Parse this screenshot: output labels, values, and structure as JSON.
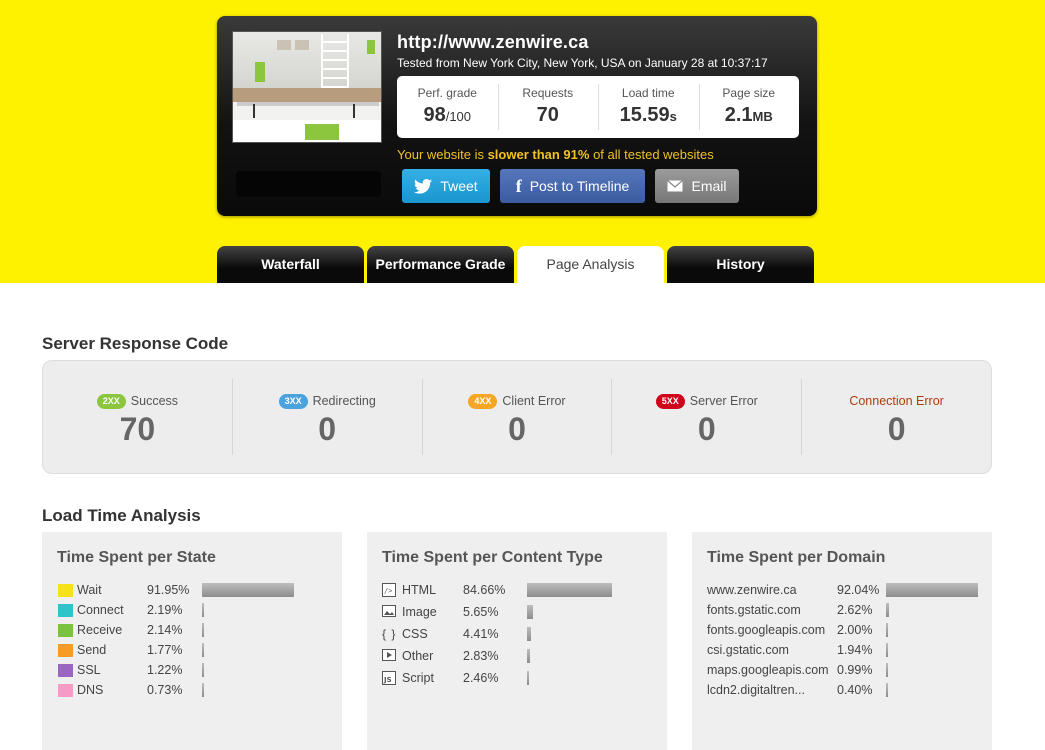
{
  "hero": {
    "url": "http://www.zenwire.ca",
    "tested_line": "Tested from New York City, New York, USA on January 28 at 10:37:17",
    "stats": [
      {
        "label": "Perf. grade",
        "value": "98",
        "unit": "/100"
      },
      {
        "label": "Requests",
        "value": "70",
        "unit": ""
      },
      {
        "label": "Load time",
        "value": "15.59",
        "unit": "s"
      },
      {
        "label": "Page size",
        "value": "2.1",
        "unit": "MB"
      }
    ],
    "speed": {
      "prefix": "Your website is ",
      "emphasis": "slower than 91%",
      "suffix": " of all tested websites"
    },
    "share": {
      "tweet": "Tweet",
      "facebook": "Post to Timeline",
      "email": "Email"
    }
  },
  "tabs": [
    {
      "label": "Waterfall",
      "active": false
    },
    {
      "label": "Performance Grade",
      "active": false
    },
    {
      "label": "Page Analysis",
      "active": true
    },
    {
      "label": "History",
      "active": false
    }
  ],
  "server_response": {
    "title": "Server Response Code",
    "codes": [
      {
        "badge": "2XX",
        "label": "Success",
        "count": "70",
        "color": "#8cc63f"
      },
      {
        "badge": "3XX",
        "label": "Redirecting",
        "count": "0",
        "color": "#4aa3df"
      },
      {
        "badge": "4XX",
        "label": "Client Error",
        "count": "0",
        "color": "#f5a623"
      },
      {
        "badge": "5XX",
        "label": "Server Error",
        "count": "0",
        "color": "#d0021b"
      },
      {
        "badge": "",
        "label": "Connection Error",
        "count": "0",
        "color": "#b03a10"
      }
    ]
  },
  "load_time": {
    "title": "Load Time Analysis",
    "per_state": {
      "title": "Time Spent per State",
      "rows": [
        {
          "label": "Wait",
          "pct": "91.95%",
          "value": 91.95,
          "color": "#f7e21a"
        },
        {
          "label": "Connect",
          "pct": "2.19%",
          "value": 2.19,
          "color": "#2ec4c9"
        },
        {
          "label": "Receive",
          "pct": "2.14%",
          "value": 2.14,
          "color": "#7cc242"
        },
        {
          "label": "Send",
          "pct": "1.77%",
          "value": 1.77,
          "color": "#f59c26"
        },
        {
          "label": "SSL",
          "pct": "1.22%",
          "value": 1.22,
          "color": "#9b65c2"
        },
        {
          "label": "DNS",
          "pct": "0.73%",
          "value": 0.73,
          "color": "#f59bc6"
        }
      ]
    },
    "per_content": {
      "title": "Time Spent per Content Type",
      "rows": [
        {
          "label": "HTML",
          "pct": "84.66%",
          "value": 84.66,
          "icon": "html-icon"
        },
        {
          "label": "Image",
          "pct": "5.65%",
          "value": 5.65,
          "icon": "image-icon"
        },
        {
          "label": "CSS",
          "pct": "4.41%",
          "value": 4.41,
          "icon": "css-icon"
        },
        {
          "label": "Other",
          "pct": "2.83%",
          "value": 2.83,
          "icon": "other-icon"
        },
        {
          "label": "Script",
          "pct": "2.46%",
          "value": 2.46,
          "icon": "script-icon"
        }
      ]
    },
    "per_domain": {
      "title": "Time Spent per Domain",
      "rows": [
        {
          "label": "www.zenwire.ca",
          "pct": "92.04%",
          "value": 92.04
        },
        {
          "label": "fonts.gstatic.com",
          "pct": "2.62%",
          "value": 2.62
        },
        {
          "label": "fonts.googleapis.com",
          "pct": "2.00%",
          "value": 2.0
        },
        {
          "label": "csi.gstatic.com",
          "pct": "1.94%",
          "value": 1.94
        },
        {
          "label": "maps.googleapis.com",
          "pct": "0.99%",
          "value": 0.99
        },
        {
          "label": "lcdn2.digitaltren...",
          "pct": "0.40%",
          "value": 0.4
        }
      ]
    }
  }
}
